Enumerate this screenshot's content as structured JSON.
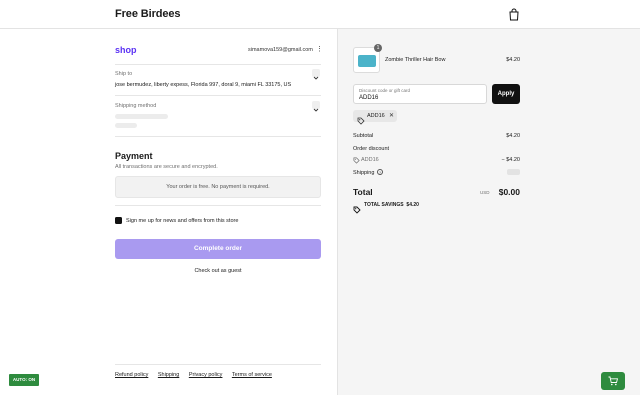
{
  "header": {
    "store_name": "Free Birdees",
    "icons": {
      "cart": "shopping-bag-icon"
    }
  },
  "account": {
    "shop_logo": "shop",
    "email": "simamova159@gmail.com",
    "menu_icon": "⋮"
  },
  "shipping": {
    "ship_to_label": "Ship to",
    "ship_to_value": "jose bermudez, liberty expess, Florida 997, doral 9, miami FL 33175, US",
    "method_label": "Shipping method"
  },
  "payment": {
    "title": "Payment",
    "subtitle": "All transactions are secure and encrypted.",
    "free_message": "Your order is free. No payment is required."
  },
  "newsletter": {
    "label": "Sign me up for news and offers from this store",
    "checked": true
  },
  "actions": {
    "complete_label": "Complete order",
    "guest_label": "Check out as guest"
  },
  "footer": {
    "links": [
      "Refund policy",
      "Shipping",
      "Privacy policy",
      "Terms of service"
    ]
  },
  "badge": {
    "autocoupon_label": "AUTO: ON"
  },
  "cart": {
    "item": {
      "name": "Zombie Thriller Hair Bow",
      "price": "$4.20",
      "quantity": "1"
    },
    "discount": {
      "placeholder": "Discount code or gift card",
      "value": "ADD16",
      "apply_label": "Apply"
    },
    "applied_code": "ADD16",
    "summary": {
      "subtotal_label": "Subtotal",
      "subtotal_value": "$4.20",
      "order_discount_label": "Order discount",
      "discount_code": "ADD16",
      "discount_value": "− $4.20",
      "shipping_label": "Shipping",
      "total_label": "Total",
      "total_currency": "USD",
      "total_value": "$0.00",
      "savings_label": "TOTAL SAVINGS",
      "savings_value": "$4.20"
    }
  },
  "colors": {
    "shop_purple": "#5a31f4",
    "complete_button": "#a99af0",
    "green": "#2e8b3e"
  }
}
